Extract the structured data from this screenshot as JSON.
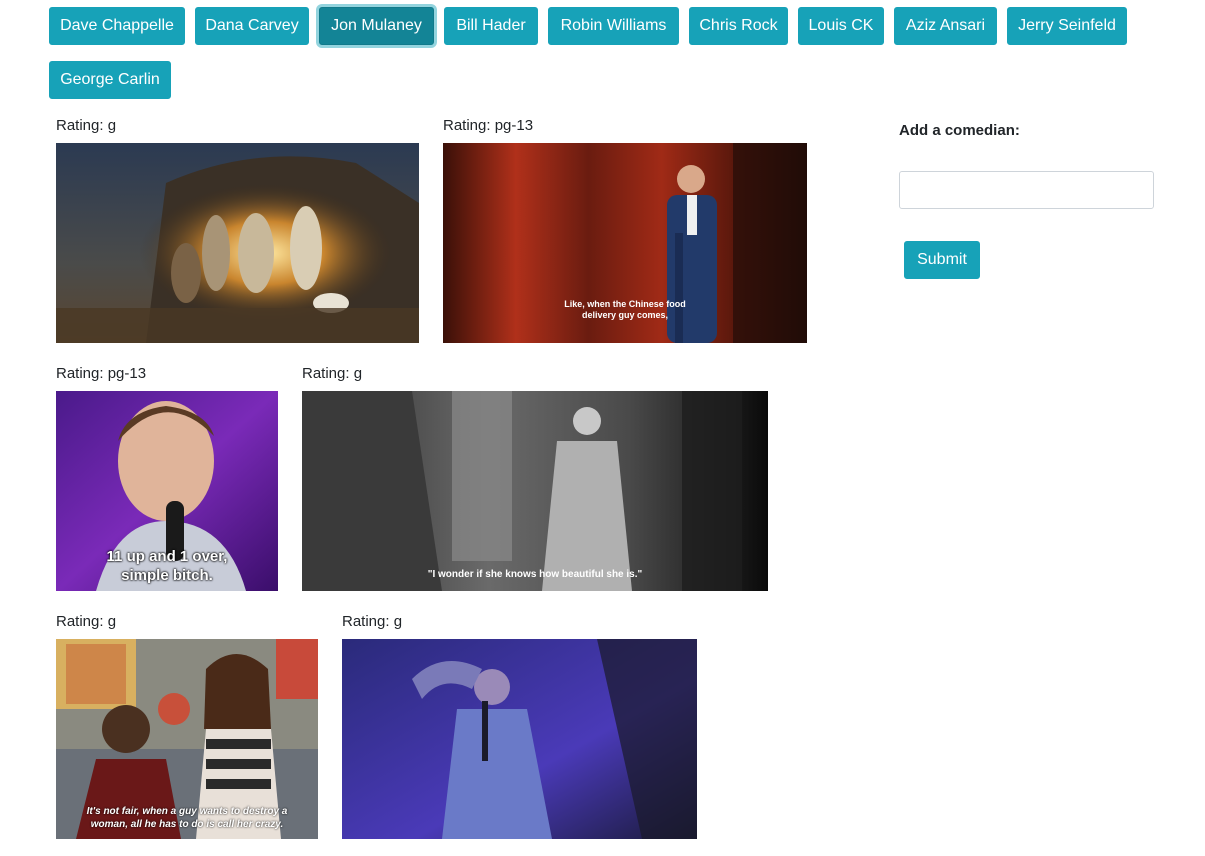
{
  "comedian_buttons": [
    {
      "label": "Dave Chappelle"
    },
    {
      "label": "Dana Carvey"
    },
    {
      "label": "Jon Mulaney"
    },
    {
      "label": "Bill Hader"
    },
    {
      "label": "Robin Williams"
    },
    {
      "label": "Chris Rock"
    },
    {
      "label": "Louis CK"
    },
    {
      "label": "Aziz Ansari"
    },
    {
      "label": "Jerry Seinfeld"
    },
    {
      "label": "George Carlin"
    }
  ],
  "active_button": "Jon Mulaney",
  "gifs": [
    {
      "rating": "Rating: g",
      "caption": ""
    },
    {
      "rating": "Rating: pg-13",
      "caption": "Like, when the Chinese food\ndelivery guy comes,"
    },
    {
      "rating": "Rating: pg-13",
      "caption": "11 up and 1 over,\nsimple bitch."
    },
    {
      "rating": "Rating: g",
      "caption": "\"I wonder if she knows how beautiful she is.\""
    },
    {
      "rating": "Rating: g",
      "caption": "It's not fair, when a guy wants to destroy a\nwoman, all he has to do is call her crazy."
    },
    {
      "rating": "Rating: g",
      "caption": ""
    }
  ],
  "form": {
    "label": "Add a comedian:",
    "input_value": "",
    "submit_label": "Submit"
  },
  "colors": {
    "button": "#17a2b8",
    "button_active": "#138496"
  }
}
